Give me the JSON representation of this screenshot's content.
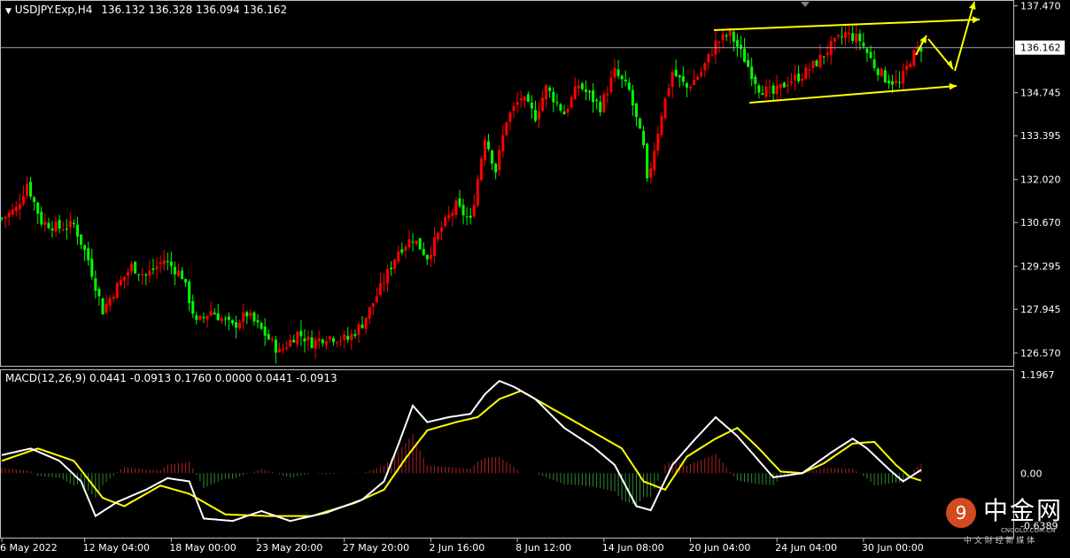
{
  "header": {
    "symbol": "USDJPY.Exp,H4",
    "ohlc": "136.132 136.328 136.094 136.162",
    "macd_label": "MACD(12,26,9) 0.0441 -0.0913 0.1760 0.0000 0.0441 -0.0913"
  },
  "price_axis": {
    "ticks": [
      "137.470",
      "136.162",
      "134.745",
      "133.395",
      "132.020",
      "130.670",
      "129.295",
      "127.945",
      "126.570"
    ],
    "current": "136.162"
  },
  "macd_axis": {
    "ticks": [
      "1.1967",
      "0.00",
      "-0.6389"
    ]
  },
  "time_axis": {
    "ticks": [
      "6 May 2022",
      "12 May 04:00",
      "18 May 00:00",
      "23 May 20:00",
      "27 May 20:00",
      "2 Jun 16:00",
      "8 Jun 12:00",
      "14 Jun 08:00",
      "20 Jun 04:00",
      "24 Jun 04:00",
      "30 Jun 00:00"
    ]
  },
  "watermark": {
    "cn": "中金网",
    "sub": "中 文 财 经 新 媒 体",
    "url": "CNGOLD.COM.CN"
  },
  "colors": {
    "bull": "#ff0000",
    "bear": "#00ff00",
    "signal": "#ffff00",
    "macd": "#ffffff",
    "arrows": "#ffff00"
  },
  "chart_data": {
    "type": "candlestick",
    "title": "USDJPY.Exp,H4",
    "ylim": [
      126.2,
      137.6
    ],
    "anchors_close": [
      [
        0,
        130.8
      ],
      [
        4,
        131.1
      ],
      [
        7,
        131.9
      ],
      [
        11,
        130.7
      ],
      [
        16,
        130.5
      ],
      [
        20,
        130.6
      ],
      [
        24,
        129.5
      ],
      [
        28,
        127.9
      ],
      [
        31,
        128.5
      ],
      [
        36,
        129.3
      ],
      [
        40,
        129.0
      ],
      [
        45,
        129.5
      ],
      [
        50,
        129.0
      ],
      [
        54,
        127.5
      ],
      [
        58,
        127.9
      ],
      [
        64,
        127.4
      ],
      [
        68,
        127.8
      ],
      [
        72,
        127.3
      ],
      [
        77,
        126.6
      ],
      [
        82,
        127.2
      ],
      [
        86,
        126.9
      ],
      [
        90,
        127.1
      ],
      [
        96,
        127.0
      ],
      [
        100,
        127.5
      ],
      [
        105,
        128.6
      ],
      [
        110,
        129.8
      ],
      [
        114,
        130.2
      ],
      [
        118,
        129.6
      ],
      [
        122,
        130.5
      ],
      [
        126,
        131.2
      ],
      [
        130,
        130.7
      ],
      [
        134,
        133.4
      ],
      [
        137,
        132.3
      ],
      [
        140,
        133.9
      ],
      [
        144,
        134.6
      ],
      [
        148,
        134.0
      ],
      [
        151,
        134.9
      ],
      [
        156,
        134.1
      ],
      [
        160,
        135.0
      ],
      [
        166,
        134.3
      ],
      [
        170,
        135.4
      ],
      [
        174,
        134.8
      ],
      [
        178,
        133.0
      ],
      [
        179,
        131.9
      ],
      [
        183,
        134.1
      ],
      [
        186,
        135.4
      ],
      [
        190,
        134.9
      ],
      [
        194,
        135.4
      ],
      [
        198,
        136.3
      ],
      [
        202,
        136.6
      ],
      [
        206,
        135.8
      ],
      [
        210,
        134.9
      ],
      [
        214,
        134.7
      ],
      [
        218,
        135.1
      ],
      [
        222,
        135.3
      ],
      [
        226,
        135.7
      ],
      [
        230,
        136.2
      ],
      [
        234,
        136.6
      ],
      [
        238,
        136.4
      ],
      [
        242,
        135.6
      ],
      [
        245,
        135.2
      ],
      [
        249,
        135.0
      ],
      [
        252,
        135.8
      ],
      [
        254,
        136.1
      ],
      [
        255,
        136.162
      ]
    ],
    "x_range": [
      0,
      255
    ],
    "macd_ylim": [
      -0.75,
      1.25
    ],
    "macd_series": [
      [
        0,
        0.22
      ],
      [
        8,
        0.3
      ],
      [
        16,
        0.15
      ],
      [
        22,
        -0.1
      ],
      [
        26,
        -0.52
      ],
      [
        32,
        -0.35
      ],
      [
        40,
        -0.2
      ],
      [
        46,
        -0.06
      ],
      [
        52,
        -0.1
      ],
      [
        56,
        -0.55
      ],
      [
        64,
        -0.58
      ],
      [
        72,
        -0.46
      ],
      [
        80,
        -0.58
      ],
      [
        90,
        -0.48
      ],
      [
        100,
        -0.32
      ],
      [
        106,
        -0.1
      ],
      [
        110,
        0.35
      ],
      [
        114,
        0.82
      ],
      [
        118,
        0.62
      ],
      [
        124,
        0.68
      ],
      [
        130,
        0.72
      ],
      [
        134,
        0.96
      ],
      [
        138,
        1.12
      ],
      [
        142,
        1.05
      ],
      [
        148,
        0.9
      ],
      [
        156,
        0.55
      ],
      [
        164,
        0.32
      ],
      [
        170,
        0.1
      ],
      [
        176,
        -0.4
      ],
      [
        180,
        -0.45
      ],
      [
        186,
        0.1
      ],
      [
        192,
        0.4
      ],
      [
        198,
        0.68
      ],
      [
        204,
        0.45
      ],
      [
        210,
        0.15
      ],
      [
        214,
        -0.05
      ],
      [
        222,
        0.0
      ],
      [
        230,
        0.25
      ],
      [
        236,
        0.42
      ],
      [
        240,
        0.3
      ],
      [
        246,
        0.05
      ],
      [
        250,
        -0.1
      ],
      [
        255,
        0.04
      ]
    ],
    "signal_series": [
      [
        0,
        0.15
      ],
      [
        10,
        0.3
      ],
      [
        20,
        0.15
      ],
      [
        28,
        -0.3
      ],
      [
        34,
        -0.4
      ],
      [
        44,
        -0.15
      ],
      [
        52,
        -0.25
      ],
      [
        62,
        -0.5
      ],
      [
        74,
        -0.52
      ],
      [
        86,
        -0.52
      ],
      [
        98,
        -0.36
      ],
      [
        106,
        -0.2
      ],
      [
        112,
        0.18
      ],
      [
        118,
        0.52
      ],
      [
        126,
        0.62
      ],
      [
        132,
        0.68
      ],
      [
        138,
        0.9
      ],
      [
        144,
        1.0
      ],
      [
        150,
        0.85
      ],
      [
        158,
        0.65
      ],
      [
        166,
        0.45
      ],
      [
        172,
        0.3
      ],
      [
        178,
        -0.1
      ],
      [
        184,
        -0.2
      ],
      [
        190,
        0.2
      ],
      [
        198,
        0.42
      ],
      [
        204,
        0.55
      ],
      [
        210,
        0.3
      ],
      [
        216,
        0.02
      ],
      [
        222,
        0.0
      ],
      [
        228,
        0.12
      ],
      [
        236,
        0.36
      ],
      [
        242,
        0.38
      ],
      [
        248,
        0.1
      ],
      [
        252,
        -0.05
      ],
      [
        255,
        -0.09
      ]
    ],
    "hist_note": "histogram = macd - signal"
  }
}
